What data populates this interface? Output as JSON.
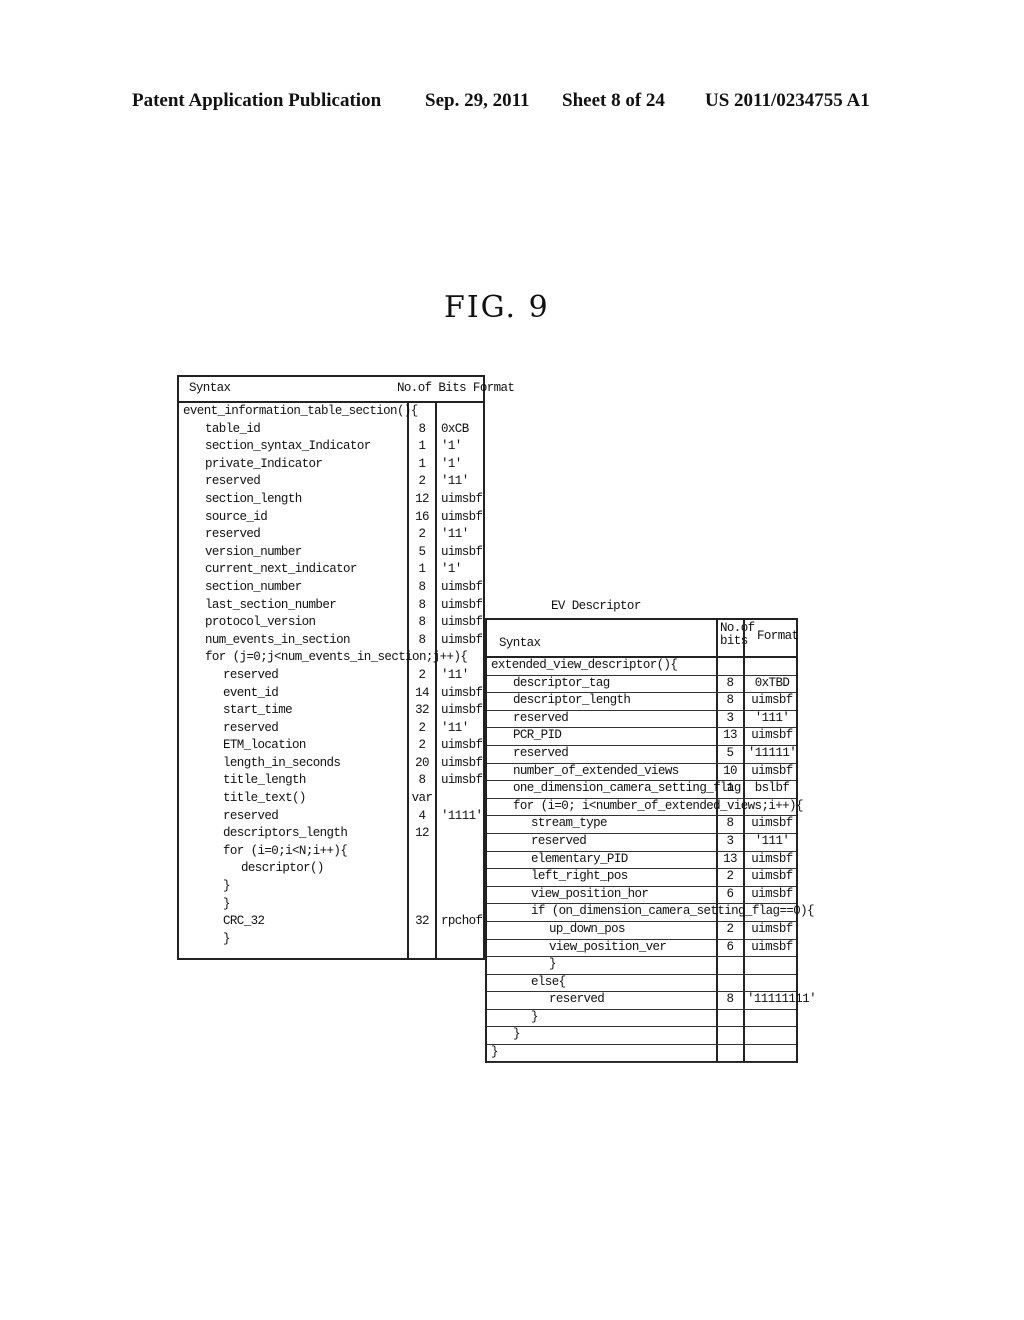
{
  "header": {
    "publication": "Patent Application Publication",
    "date": "Sep. 29, 2011",
    "sheet": "Sheet 8 of 24",
    "number": "US 2011/0234755 A1"
  },
  "figure_label": "FIG. 9",
  "eit_table": {
    "headers": {
      "syntax": "Syntax",
      "bits_format": "No.of Bits Format"
    },
    "rows": [
      {
        "syntax": "event_information_table_section(){",
        "indent": 0,
        "bits": "",
        "format": ""
      },
      {
        "syntax": "table_id",
        "indent": 1,
        "bits": "8",
        "format": "0xCB"
      },
      {
        "syntax": "section_syntax_Indicator",
        "indent": 1,
        "bits": "1",
        "format": "'1'"
      },
      {
        "syntax": "private_Indicator",
        "indent": 1,
        "bits": "1",
        "format": "'1'"
      },
      {
        "syntax": "reserved",
        "indent": 1,
        "bits": "2",
        "format": "'11'"
      },
      {
        "syntax": "section_length",
        "indent": 1,
        "bits": "12",
        "format": "uimsbf"
      },
      {
        "syntax": "source_id",
        "indent": 1,
        "bits": "16",
        "format": "uimsbf"
      },
      {
        "syntax": "reserved",
        "indent": 1,
        "bits": "2",
        "format": "'11'"
      },
      {
        "syntax": "version_number",
        "indent": 1,
        "bits": "5",
        "format": "uimsbf"
      },
      {
        "syntax": "current_next_indicator",
        "indent": 1,
        "bits": "1",
        "format": "'1'"
      },
      {
        "syntax": "section_number",
        "indent": 1,
        "bits": "8",
        "format": "uimsbf"
      },
      {
        "syntax": "last_section_number",
        "indent": 1,
        "bits": "8",
        "format": "uimsbf"
      },
      {
        "syntax": "protocol_version",
        "indent": 1,
        "bits": "8",
        "format": "uimsbf"
      },
      {
        "syntax": "num_events_in_section",
        "indent": 1,
        "bits": "8",
        "format": "uimsbf"
      },
      {
        "syntax": "for (j=0;j<num_events_in_section;j++){",
        "indent": 1,
        "bits": "",
        "format": ""
      },
      {
        "syntax": "reserved",
        "indent": 2,
        "bits": "2",
        "format": "'11'"
      },
      {
        "syntax": "event_id",
        "indent": 2,
        "bits": "14",
        "format": "uimsbf"
      },
      {
        "syntax": "start_time",
        "indent": 2,
        "bits": "32",
        "format": "uimsbf"
      },
      {
        "syntax": "reserved",
        "indent": 2,
        "bits": "2",
        "format": "'11'"
      },
      {
        "syntax": "ETM_location",
        "indent": 2,
        "bits": "2",
        "format": "uimsbf"
      },
      {
        "syntax": "length_in_seconds",
        "indent": 2,
        "bits": "20",
        "format": "uimsbf"
      },
      {
        "syntax": "title_length",
        "indent": 2,
        "bits": "8",
        "format": "uimsbf"
      },
      {
        "syntax": "title_text()",
        "indent": 2,
        "bits": "var",
        "format": ""
      },
      {
        "syntax": "reserved",
        "indent": 2,
        "bits": "4",
        "format": "'1111'"
      },
      {
        "syntax": "descriptors_length",
        "indent": 2,
        "bits": "12",
        "format": ""
      },
      {
        "syntax": "for (i=0;i<N;i++){",
        "indent": 2,
        "bits": "",
        "format": ""
      },
      {
        "syntax": "descriptor()",
        "indent": 3,
        "bits": "",
        "format": ""
      },
      {
        "syntax": "}",
        "indent": 2,
        "bits": "",
        "format": ""
      },
      {
        "syntax": "}",
        "indent": 2,
        "bits": "",
        "format": ""
      },
      {
        "syntax": "CRC_32",
        "indent": 2,
        "bits": "32",
        "format": "rpchof"
      },
      {
        "syntax": "}",
        "indent": 2,
        "bits": "",
        "format": ""
      }
    ]
  },
  "ev_table": {
    "title": "EV Descriptor",
    "headers": {
      "syntax": "Syntax",
      "bits_line1": "No.of",
      "bits_line2": "bits",
      "format": "Format"
    },
    "rows": [
      {
        "syntax": "extended_view_descriptor(){",
        "indent": 0,
        "bits": "",
        "format": ""
      },
      {
        "syntax": "descriptor_tag",
        "indent": 1,
        "bits": "8",
        "format": "0xTBD"
      },
      {
        "syntax": "descriptor_length",
        "indent": 1,
        "bits": "8",
        "format": "uimsbf"
      },
      {
        "syntax": "reserved",
        "indent": 1,
        "bits": "3",
        "format": "'111'"
      },
      {
        "syntax": "PCR_PID",
        "indent": 1,
        "bits": "13",
        "format": "uimsbf"
      },
      {
        "syntax": "reserved",
        "indent": 1,
        "bits": "5",
        "format": "'11111'"
      },
      {
        "syntax": "number_of_extended_views",
        "indent": 1,
        "bits": "10",
        "format": "uimsbf"
      },
      {
        "syntax": "one_dimension_camera_setting_flag",
        "indent": 1,
        "bits": "1",
        "format": "bslbf"
      },
      {
        "syntax": "for (i=0; i<number_of_extended_views;i++){",
        "indent": 1,
        "bits": "",
        "format": ""
      },
      {
        "syntax": "stream_type",
        "indent": 2,
        "bits": "8",
        "format": "uimsbf"
      },
      {
        "syntax": "reserved",
        "indent": 2,
        "bits": "3",
        "format": "'111'"
      },
      {
        "syntax": "elementary_PID",
        "indent": 2,
        "bits": "13",
        "format": "uimsbf"
      },
      {
        "syntax": "left_right_pos",
        "indent": 2,
        "bits": "2",
        "format": "uimsbf"
      },
      {
        "syntax": "view_position_hor",
        "indent": 2,
        "bits": "6",
        "format": "uimsbf"
      },
      {
        "syntax": "if (on_dimension_camera_setting_flag==0){",
        "indent": 2,
        "bits": "",
        "format": ""
      },
      {
        "syntax": "up_down_pos",
        "indent": 3,
        "bits": "2",
        "format": "uimsbf"
      },
      {
        "syntax": "view_position_ver",
        "indent": 3,
        "bits": "6",
        "format": "uimsbf"
      },
      {
        "syntax": "}",
        "indent": 3,
        "bits": "",
        "format": ""
      },
      {
        "syntax": "else{",
        "indent": 2,
        "bits": "",
        "format": ""
      },
      {
        "syntax": "reserved",
        "indent": 3,
        "bits": "8",
        "format": "'11111111'"
      },
      {
        "syntax": "}",
        "indent": 2,
        "bits": "",
        "format": ""
      },
      {
        "syntax": "}",
        "indent": 1,
        "bits": "",
        "format": ""
      },
      {
        "syntax": "}",
        "indent": 0,
        "bits": "",
        "format": ""
      }
    ]
  }
}
